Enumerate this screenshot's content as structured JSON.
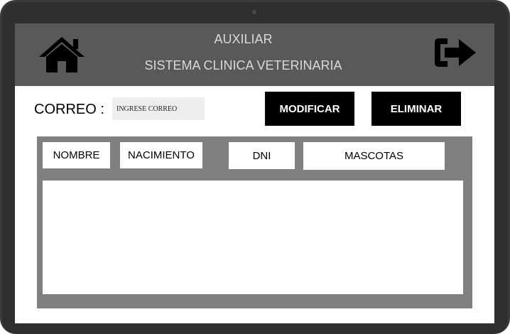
{
  "header": {
    "title": "AUXILIAR",
    "subtitle": "SISTEMA CLINICA VETERINARIA",
    "home_icon": "home-icon",
    "logout_icon": "logout-icon"
  },
  "search": {
    "label": "CORREO :",
    "placeholder": "INGRESE CORREO",
    "value": ""
  },
  "actions": {
    "modify_label": "MODIFICAR",
    "delete_label": "ELIMINAR"
  },
  "table": {
    "columns": [
      "NOMBRE",
      "NACIMIENTO",
      "DNI",
      "MASCOTAS"
    ],
    "rows": []
  },
  "colors": {
    "header_bg": "#595959",
    "header_text": "#d9d9d9",
    "button_bg": "#000000",
    "panel_bg": "#808080",
    "input_bg": "#eeeeee"
  }
}
